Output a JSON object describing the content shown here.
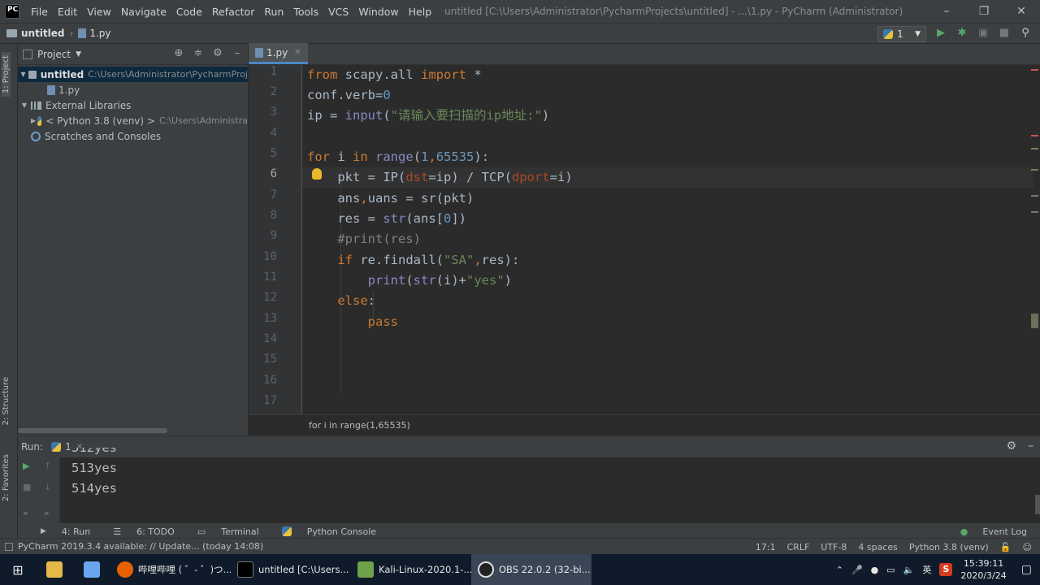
{
  "window": {
    "logo": "PC",
    "title": "untitled [C:\\Users\\Administrator\\PycharmProjects\\untitled] - ...\\1.py - PyCharm (Administrator)"
  },
  "menu": [
    "File",
    "Edit",
    "View",
    "Navigate",
    "Code",
    "Refactor",
    "Run",
    "Tools",
    "VCS",
    "Window",
    "Help"
  ],
  "breadcrumb": {
    "project": "untitled",
    "file": "1.py"
  },
  "run_config": "1",
  "project_panel": {
    "title": "Project",
    "tree": [
      {
        "label": "untitled",
        "path": "C:\\Users\\Administrator\\PycharmProj",
        "bold": true
      },
      {
        "label": "1.py"
      },
      {
        "label": "External Libraries"
      },
      {
        "label": "< Python 3.8 (venv) >",
        "path": "C:\\Users\\Administra"
      },
      {
        "label": "Scratches and Consoles"
      }
    ]
  },
  "side_tabs": {
    "project": "1: Project",
    "structure": "2: Structure",
    "favorites": "2: Favorites"
  },
  "editor": {
    "tab": "1.py",
    "line_numbers": [
      "1",
      "2",
      "3",
      "4",
      "5",
      "6",
      "7",
      "8",
      "9",
      "10",
      "11",
      "12",
      "13",
      "14",
      "15",
      "16",
      "17"
    ],
    "breadcrumb": "for i in range(1,65535)"
  },
  "run_panel": {
    "label": "Run:",
    "config": "1",
    "output": [
      "512yes",
      "513yes",
      "514yes"
    ]
  },
  "bottom_tabs": [
    "4: Run",
    "6: TODO",
    "Terminal",
    "Python Console"
  ],
  "event_log": "Event Log",
  "status": {
    "message": "PyCharm 2019.3.4 available: // Update... (today 14:08)",
    "position": "17:1",
    "line_sep": "CRLF",
    "encoding": "UTF-8",
    "indent": "4 spaces",
    "interpreter": "Python 3.8 (venv)"
  },
  "taskbar": {
    "items": [
      {
        "label": "哔哩哔哩 ( ゜- ゜)つ..."
      },
      {
        "label": "untitled [C:\\Users..."
      },
      {
        "label": "Kali-Linux-2020.1-..."
      },
      {
        "label": "OBS 22.0.2 (32-bi..."
      }
    ],
    "ime": "英",
    "time": "15:39:11",
    "date": "2020/3/24"
  },
  "colors": {
    "keyword": "#cc7832",
    "number": "#6897bb",
    "string": "#6a8759",
    "comment": "#808080",
    "param": "#aa4926",
    "builtin": "#8888c6",
    "text": "#a9b7c6"
  }
}
